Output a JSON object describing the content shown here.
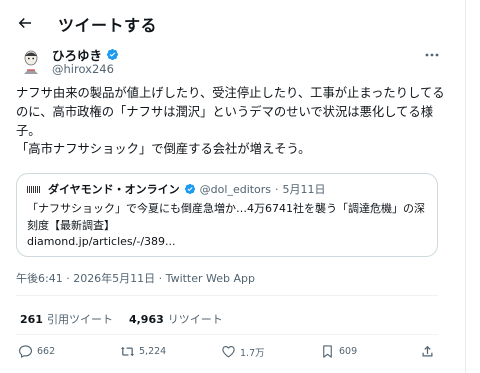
{
  "header": {
    "title": "ツイートする"
  },
  "author": {
    "name": "ひろゆき",
    "handle": "@hirox246"
  },
  "tweet": {
    "text": "ナフサ由来の製品が値上げしたり、受注停止したり、工事が止まったりしてるのに、高市政権の「ナフサは潤沢」というデマのせいで状況は悪化してる様子。\n「高市ナフサショック」で倒産する会社が増えそう。"
  },
  "card": {
    "source_name": "ダイヤモンド・オンライン",
    "source_handle": "@dol_editors",
    "dot": "·",
    "date": "5月11日",
    "body": "「ナフサショック」で今夏にも倒産急増か…4万6741社を襲う「調達危機」の深刻度【最新調査】",
    "link": "diamond.jp/articles/-/389..."
  },
  "timestamp": "午後6:41 · 2026年5月11日 · Twitter Web App",
  "stats": {
    "quotes_count": "261",
    "quotes_label": "引用ツイート",
    "retweets_count": "4,963",
    "retweets_label": "リツイート"
  },
  "actions": {
    "replies": "662",
    "retweets": "5,224",
    "likes": "1.7万",
    "bookmarks": "609"
  },
  "colors": {
    "verified": "#1d9bf0",
    "secondary": "#536471",
    "border": "#cfd9de"
  }
}
